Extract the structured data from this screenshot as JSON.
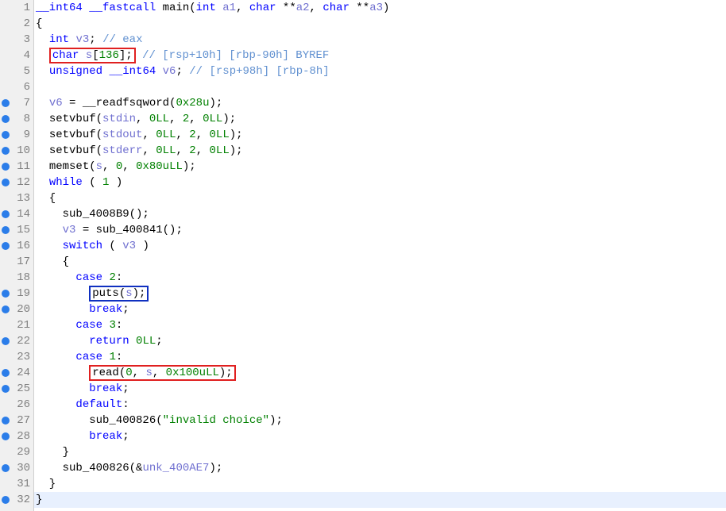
{
  "lines": [
    {
      "n": 1,
      "bp": false,
      "hl": false
    },
    {
      "n": 2,
      "bp": false,
      "hl": false
    },
    {
      "n": 3,
      "bp": false,
      "hl": false
    },
    {
      "n": 4,
      "bp": false,
      "hl": false
    },
    {
      "n": 5,
      "bp": false,
      "hl": false
    },
    {
      "n": 6,
      "bp": false,
      "hl": false
    },
    {
      "n": 7,
      "bp": true,
      "hl": false
    },
    {
      "n": 8,
      "bp": true,
      "hl": false
    },
    {
      "n": 9,
      "bp": true,
      "hl": false
    },
    {
      "n": 10,
      "bp": true,
      "hl": false
    },
    {
      "n": 11,
      "bp": true,
      "hl": false
    },
    {
      "n": 12,
      "bp": true,
      "hl": false
    },
    {
      "n": 13,
      "bp": false,
      "hl": false
    },
    {
      "n": 14,
      "bp": true,
      "hl": false
    },
    {
      "n": 15,
      "bp": true,
      "hl": false
    },
    {
      "n": 16,
      "bp": true,
      "hl": false
    },
    {
      "n": 17,
      "bp": false,
      "hl": false
    },
    {
      "n": 18,
      "bp": false,
      "hl": false
    },
    {
      "n": 19,
      "bp": true,
      "hl": false
    },
    {
      "n": 20,
      "bp": true,
      "hl": false
    },
    {
      "n": 21,
      "bp": false,
      "hl": false
    },
    {
      "n": 22,
      "bp": true,
      "hl": false
    },
    {
      "n": 23,
      "bp": false,
      "hl": false
    },
    {
      "n": 24,
      "bp": true,
      "hl": false
    },
    {
      "n": 25,
      "bp": true,
      "hl": false
    },
    {
      "n": 26,
      "bp": false,
      "hl": false
    },
    {
      "n": 27,
      "bp": true,
      "hl": false
    },
    {
      "n": 28,
      "bp": true,
      "hl": false
    },
    {
      "n": 29,
      "bp": false,
      "hl": false
    },
    {
      "n": 30,
      "bp": true,
      "hl": false
    },
    {
      "n": 31,
      "bp": false,
      "hl": false
    },
    {
      "n": 32,
      "bp": true,
      "hl": true
    }
  ],
  "sig": {
    "ret": "__int64",
    "cc": "__fastcall",
    "name": "main",
    "p1t": "int",
    "p1": "a1",
    "p2t": "char",
    "p2": "a2",
    "p3t": "char",
    "p3": "a3"
  },
  "l2": "{",
  "l3": {
    "t": "int",
    "v": "v3",
    "c": "// eax"
  },
  "l4": {
    "t": "char",
    "v": "s",
    "sz": "136",
    "c": "// [rsp+10h] [rbp-90h] BYREF"
  },
  "l5": {
    "t1": "unsigned",
    "t2": "__int64",
    "v": "v6",
    "c": "// [rsp+98h] [rbp-8h]"
  },
  "l7": {
    "v": "v6",
    "f": "__readfsqword",
    "a": "0x28u"
  },
  "l8": {
    "f": "setvbuf",
    "a1": "stdin",
    "a2": "0LL",
    "a3": "2",
    "a4": "0LL"
  },
  "l9": {
    "f": "setvbuf",
    "a1": "stdout",
    "a2": "0LL",
    "a3": "2",
    "a4": "0LL"
  },
  "l10": {
    "f": "setvbuf",
    "a1": "stderr",
    "a2": "0LL",
    "a3": "2",
    "a4": "0LL"
  },
  "l11": {
    "f": "memset",
    "a1": "s",
    "a2": "0",
    "a3": "0x80uLL"
  },
  "l12": {
    "kw": "while",
    "cond": "1"
  },
  "l13": "  {",
  "l14": {
    "f": "sub_4008B9"
  },
  "l15": {
    "v": "v3",
    "f": "sub_400841"
  },
  "l16": {
    "kw": "switch",
    "v": "v3"
  },
  "l17": "    {",
  "l18": {
    "kw": "case",
    "n": "2"
  },
  "l19": {
    "f": "puts",
    "a": "s"
  },
  "l20": {
    "kw": "break"
  },
  "l21": {
    "kw": "case",
    "n": "3"
  },
  "l22": {
    "kw": "return",
    "v": "0LL"
  },
  "l23": {
    "kw": "case",
    "n": "1"
  },
  "l24": {
    "f": "read",
    "a1": "0",
    "a2": "s",
    "a3": "0x100uLL"
  },
  "l25": {
    "kw": "break"
  },
  "l26": {
    "kw": "default"
  },
  "l27": {
    "f": "sub_400826",
    "s": "\"invalid choice\""
  },
  "l28": {
    "kw": "break"
  },
  "l29": "    }",
  "l30": {
    "f": "sub_400826",
    "a": "unk_400AE7"
  },
  "l31": "  }",
  "l32": "}"
}
